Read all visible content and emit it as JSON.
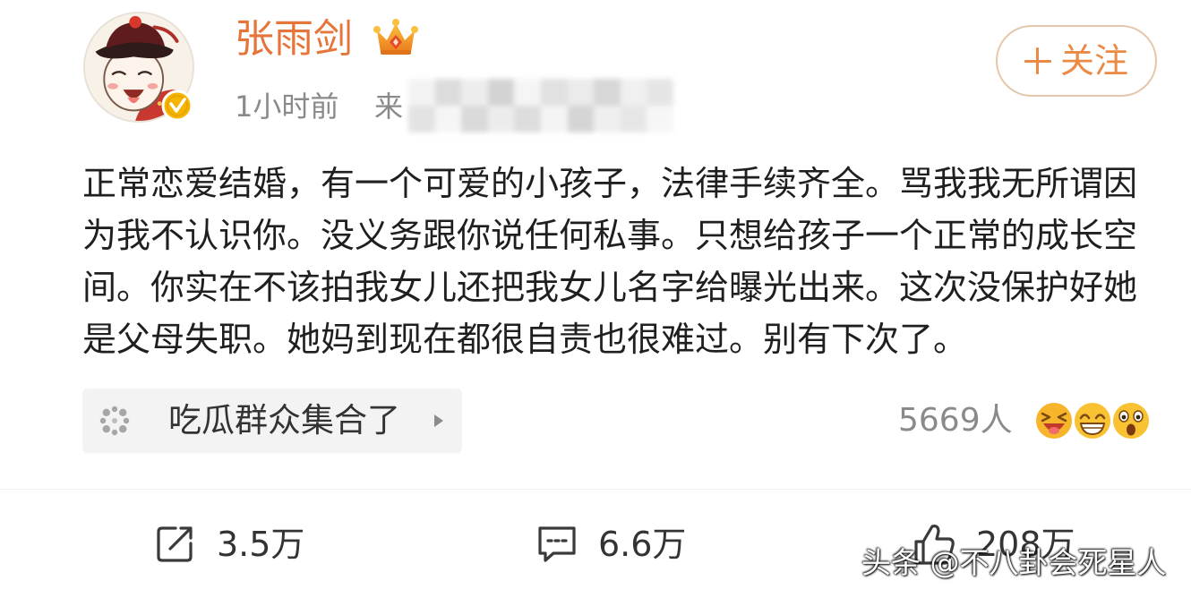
{
  "colors": {
    "author_name": "#e5763b",
    "accent": "#ea8a45",
    "follow_border": "#e3c6ab",
    "text": "#1f1f1f",
    "muted": "#8a8a8a",
    "topic_bg": "#f3f3f3",
    "verified": "#f5b400"
  },
  "post": {
    "author": {
      "name": "张雨剑",
      "avatar": "cartoon-avatar",
      "verified_icon": "verified-v-icon",
      "vip_icon": "crown-icon"
    },
    "meta": {
      "time": "1小时前",
      "source_prefix": "来"
    },
    "follow_button": {
      "icon": "plus-icon",
      "label": "关注"
    },
    "content": "正常恋爱结婚，有一个可爱的小孩子，法律手续齐全。骂我我无所谓因为我不认识你。没义务跟你说任何私事。只想给孩子一个正常的成长空间。你实在不该拍我女儿还把我女儿名字给曝光出来。这次没保护好她是父母失职。她妈到现在都很自责也很难过。别有下次了。",
    "topic": {
      "icon": "topic-dots-icon",
      "label": "吃瓜群众集合了",
      "arrow_icon": "triangle-right-icon"
    },
    "reactions": {
      "count": "5669人",
      "emojis": [
        "laughing-emoji",
        "grinning-emoji",
        "shocked-emoji"
      ]
    },
    "actions": {
      "repost": {
        "icon": "repost-icon",
        "count": "3.5万"
      },
      "comment": {
        "icon": "comment-icon",
        "count": "6.6万"
      },
      "like": {
        "icon": "thumbs-up-icon",
        "count": "208万"
      }
    }
  },
  "watermark": "头条 @不八卦会死星人"
}
